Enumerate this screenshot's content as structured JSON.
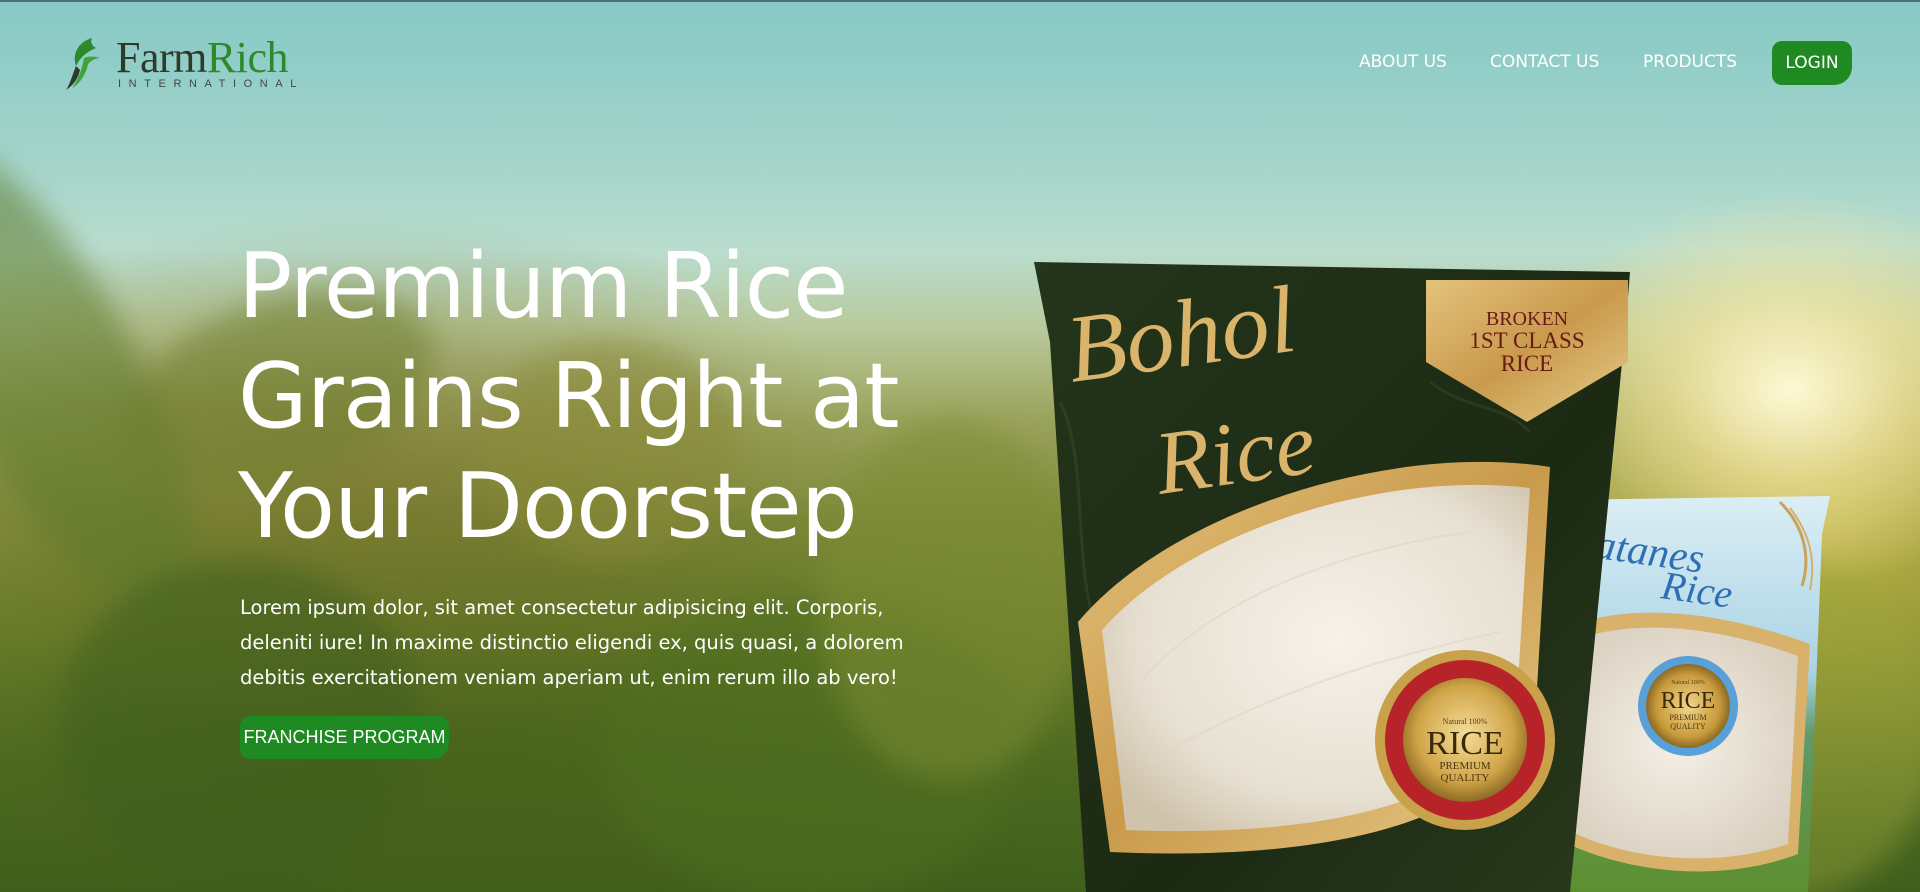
{
  "header": {
    "logo": {
      "name_part1": "Farm",
      "name_part2": "Rich",
      "subtitle": "INTERNATIONAL"
    },
    "nav": [
      {
        "label": "ABOUT US"
      },
      {
        "label": "CONTACT US"
      },
      {
        "label": "PRODUCTS"
      }
    ],
    "login_label": "LOGIN"
  },
  "hero": {
    "headline_lines": [
      "Premium Rice",
      "Grains Right at",
      "Your Doorstep"
    ],
    "description": "Lorem ipsum dolor, sit amet consectetur adipisicing elit. Corporis, deleniti iure! In maxime distinctio eligendi ex, quis quasi, a dolorem debitis exercitationem veniam aperiam ut, enim rerum illo ab vero!",
    "cta_label": "FRANCHISE PROGRAM"
  },
  "products": {
    "bohol": {
      "brand_line1": "Bohol",
      "brand_line2": "Rice",
      "tag_line1": "BROKEN",
      "tag_line2": "1ST CLASS",
      "tag_line3": "RICE",
      "seal_top": "Natural 100%",
      "seal_main": "RICE",
      "seal_sub1": "PREMIUM",
      "seal_sub2": "QUALITY"
    },
    "batanes": {
      "brand_line1": "Batanes",
      "brand_line2": "Rice",
      "seal_top": "Natural 100%",
      "seal_main": "RICE",
      "seal_sub1": "PREMIUM",
      "seal_sub2": "QUALITY"
    }
  },
  "colors": {
    "brand_green": "#1f8a22",
    "logo_green": "#2c8a2c",
    "bag_dark_green": "#1f2e17",
    "gold": "#d8b26a"
  }
}
